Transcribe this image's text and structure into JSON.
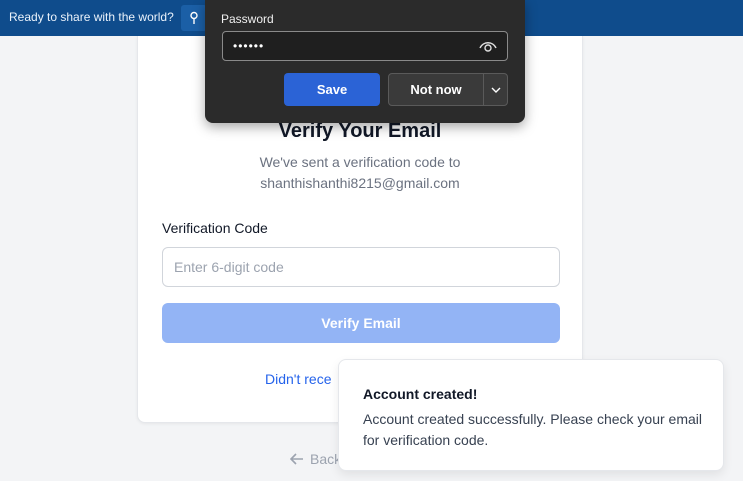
{
  "banner": {
    "text": "Ready to share with the world?",
    "icon": "pin-icon"
  },
  "password_popup": {
    "label": "Password",
    "masked_value": "••••••",
    "reveal_icon": "eye-icon",
    "save_label": "Save",
    "not_now_label": "Not now",
    "dropdown_icon": "chevron-down-icon"
  },
  "verify": {
    "title": "Verify Your Email",
    "subtitle_line1": "We've sent a verification code to",
    "email": "shanthishanthi8215@gmail.com",
    "code_label": "Verification Code",
    "code_placeholder": "Enter 6-digit code",
    "code_value": "",
    "button_label": "Verify Email",
    "resend_prefix": "Didn't rece"
  },
  "back": {
    "label": "Back",
    "icon": "arrow-left-icon"
  },
  "toast": {
    "title": "Account created!",
    "message": "Account created successfully. Please check your email for verification code."
  },
  "colors": {
    "banner_bg": "#0f4c8c",
    "primary": "#2b63d6",
    "verify_button_disabled": "#93b4f5",
    "link": "#2563eb",
    "popup_bg": "#2b2b2b"
  }
}
